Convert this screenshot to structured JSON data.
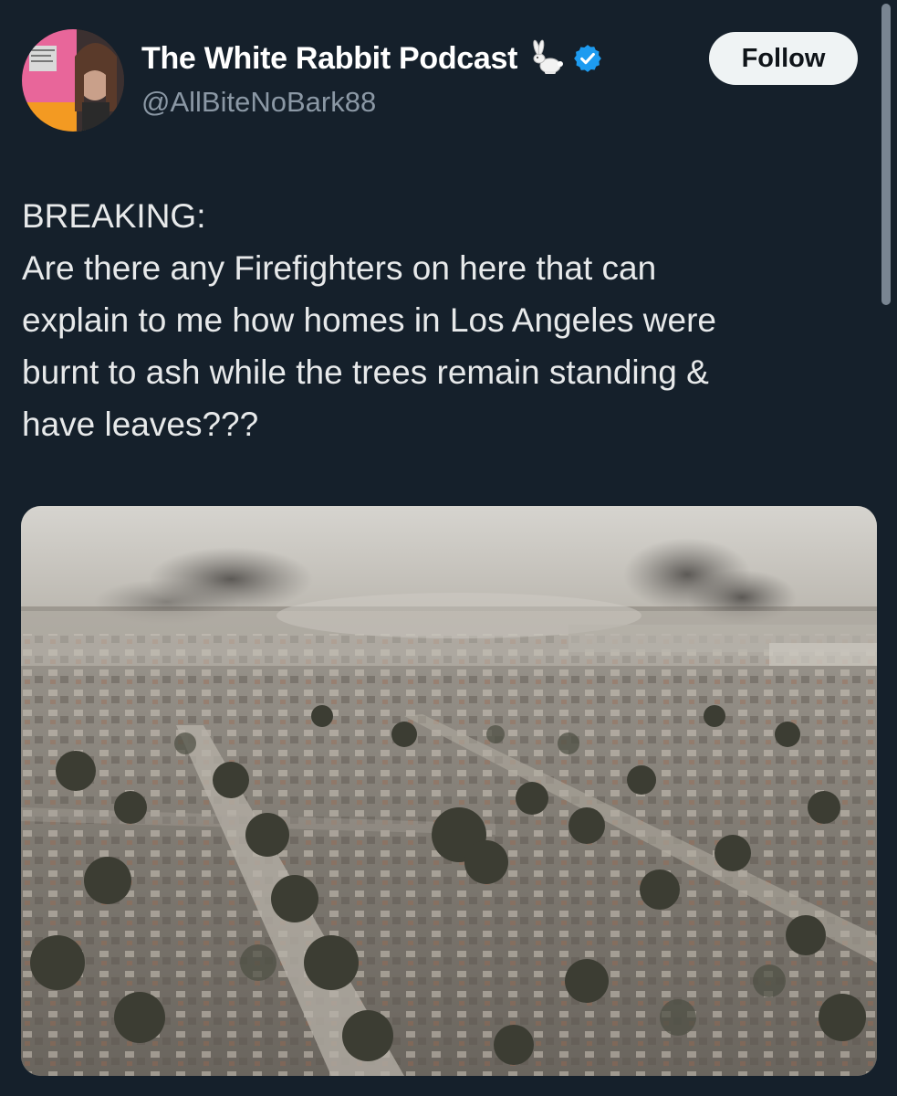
{
  "author": {
    "display_name": "The White Rabbit Podcast",
    "handle": "@AllBiteNoBark88",
    "name_emoji_icon": "rabbit-icon",
    "verified_icon": "verified-badge-icon",
    "verified_color": "#1d9bf0"
  },
  "follow": {
    "label": "Follow"
  },
  "tweet": {
    "lines": [
      "BREAKING:",
      "Are there any Firefighters on here that can",
      "explain to me how homes in Los Angeles were",
      "burnt to ash while the trees remain standing &",
      "have leaves???"
    ]
  },
  "colors": {
    "background": "#15202b",
    "primary_text": "#e7e9ea",
    "secondary_text": "#8b98a5",
    "button_bg": "#eff3f4"
  }
}
